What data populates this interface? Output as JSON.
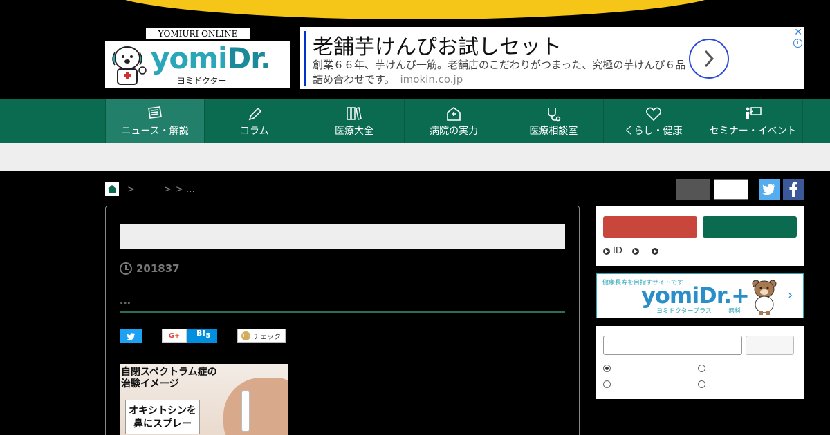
{
  "header": {
    "logo_online": "YOMIURI ONLINE",
    "logo_yomi": "yomi",
    "logo_dr": "Dr.",
    "logo_kana": "ヨミドクター"
  },
  "ad": {
    "title": "老舗芋けんぴお試しセット",
    "description": "創業６６年、芋けんぴ一筋。老舗店のこだわりがつまった、究極の芋けんぴ６品詰め合わせです。",
    "domain": "imokin.co.jp",
    "close_glyph": "✕",
    "info_glyph": "i"
  },
  "nav": {
    "items": [
      {
        "label": "ニュース・解説",
        "icon": "newspaper-icon"
      },
      {
        "label": "コラム",
        "icon": "pencil-icon"
      },
      {
        "label": "医療大全",
        "icon": "books-icon"
      },
      {
        "label": "病院の実力",
        "icon": "hospital-icon"
      },
      {
        "label": "医療相談室",
        "icon": "stethoscope-icon"
      },
      {
        "label": "くらし・健康",
        "icon": "heart-icon"
      },
      {
        "label": "セミナー・イベント",
        "icon": "presenter-icon"
      }
    ]
  },
  "breadcrumb": {
    "sep1": ">",
    "sep2": ">",
    "sep3": "> …"
  },
  "article": {
    "date": "201837",
    "author": "…",
    "image": {
      "caption_line1": "自閉スペクトラム症の",
      "caption_line2": "治験イメージ",
      "label_line1": "オキシトシンを",
      "label_line2": "鼻にスプレー"
    },
    "share": {
      "google": "G+",
      "hatena": "B!",
      "hatena_count": "5",
      "mixi_m": "m",
      "mixi_label": "チェック"
    }
  },
  "sidebar": {
    "login_links": [
      "ID",
      "",
      ""
    ],
    "banner": {
      "tag": "健康長寿を目指すサイトです",
      "logo": "yomiDr.+",
      "kana": "ヨミドクタープラス",
      "free": "無料",
      "chevron": "›"
    }
  },
  "colors": {
    "nav_green": "#0b6b50",
    "accent_yellow": "#f5c518",
    "login_red": "#c9463d",
    "brand_teal": "#2aa6b8"
  }
}
